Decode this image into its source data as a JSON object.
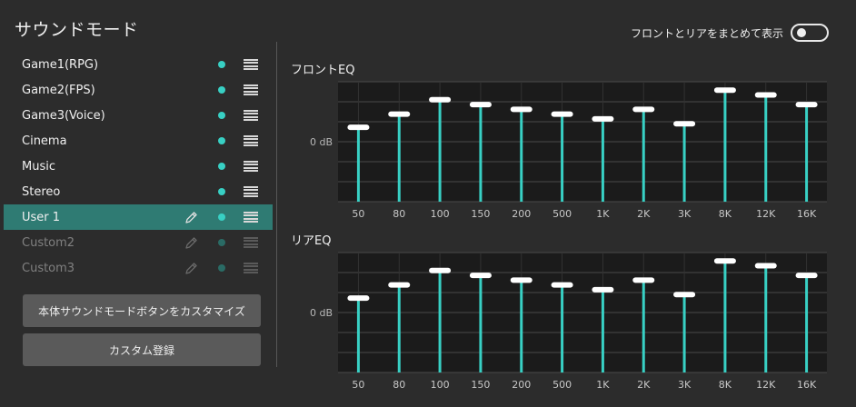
{
  "page": {
    "title": "サウンドモード",
    "toggle_label": "フロントとリアをまとめて表示",
    "toggle_on": false
  },
  "modes": [
    {
      "label": "Game1(RPG)",
      "selected": false,
      "disabled": false,
      "editable": false
    },
    {
      "label": "Game2(FPS)",
      "selected": false,
      "disabled": false,
      "editable": false
    },
    {
      "label": "Game3(Voice)",
      "selected": false,
      "disabled": false,
      "editable": false
    },
    {
      "label": "Cinema",
      "selected": false,
      "disabled": false,
      "editable": false
    },
    {
      "label": "Music",
      "selected": false,
      "disabled": false,
      "editable": false
    },
    {
      "label": "Stereo",
      "selected": false,
      "disabled": false,
      "editable": false
    },
    {
      "label": "User 1",
      "selected": true,
      "disabled": false,
      "editable": true
    },
    {
      "label": "Custom2",
      "selected": false,
      "disabled": true,
      "editable": true
    },
    {
      "label": "Custom3",
      "selected": false,
      "disabled": true,
      "editable": true
    }
  ],
  "buttons": {
    "customize_label": "本体サウンドモードボタンをカスタマイズ",
    "register_label": "カスタム登録"
  },
  "eq": {
    "zero_label": "0 dB",
    "bands": [
      "50",
      "80",
      "100",
      "150",
      "200",
      "500",
      "1K",
      "2K",
      "3K",
      "8K",
      "12K",
      "16K"
    ],
    "front": {
      "title": "フロントEQ",
      "levels": [
        0.62,
        0.73,
        0.85,
        0.81,
        0.77,
        0.73,
        0.69,
        0.77,
        0.65,
        0.93,
        0.89,
        0.81
      ]
    },
    "rear": {
      "title": "リアEQ",
      "levels": [
        0.62,
        0.73,
        0.85,
        0.81,
        0.77,
        0.73,
        0.69,
        0.77,
        0.65,
        0.93,
        0.89,
        0.81
      ]
    }
  },
  "colors": {
    "accent": "#38d0c4",
    "selected_row": "#2f7b73",
    "background": "#2c2c2c",
    "eq_panel": "#1b1b1b"
  }
}
